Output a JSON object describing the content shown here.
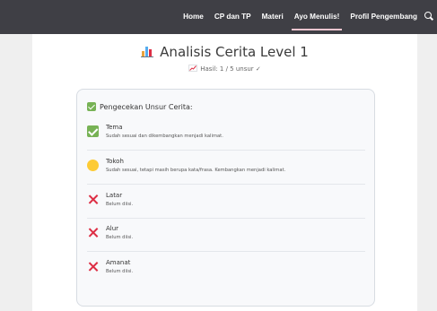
{
  "nav": {
    "items": [
      {
        "label": "Home"
      },
      {
        "label": "CP dan TP"
      },
      {
        "label": "Materi"
      },
      {
        "label": "Ayo Menulis!",
        "active": true
      },
      {
        "label": "Profil Pengembang"
      }
    ],
    "search_icon": "search-icon",
    "active_underline_color": "#f2c5cf",
    "bar_color": "#3f3f45"
  },
  "header": {
    "icon": "bar-chart-icon",
    "title": "Analisis Cerita Level 1",
    "result_icon": "trend-up-icon",
    "result": "Hasil: 1 / 5 unsur ✓"
  },
  "check_panel": {
    "icon": "check-box-icon",
    "title": "Pengecekan Unsur Cerita:",
    "items": [
      {
        "status": "complete",
        "icon": "check-box-icon",
        "name": "Tema",
        "desc": "Sudah sesuai dan dikembangkan menjadi kalimat."
      },
      {
        "status": "partial",
        "icon": "yellow-circle-icon",
        "name": "Tokoh",
        "desc": "Sudah sesuai, tetapi masih berupa kata/frasa. Kembangkan menjadi kalimat."
      },
      {
        "status": "missing",
        "icon": "cross-mark-icon",
        "name": "Latar",
        "desc": "Belum diisi."
      },
      {
        "status": "missing",
        "icon": "cross-mark-icon",
        "name": "Alur",
        "desc": "Belum diisi."
      },
      {
        "status": "missing",
        "icon": "cross-mark-icon",
        "name": "Amanat",
        "desc": "Belum diisi."
      }
    ]
  },
  "colors": {
    "complete": "#77b255",
    "partial": "#fdcb35",
    "missing": "#dd2e44"
  }
}
